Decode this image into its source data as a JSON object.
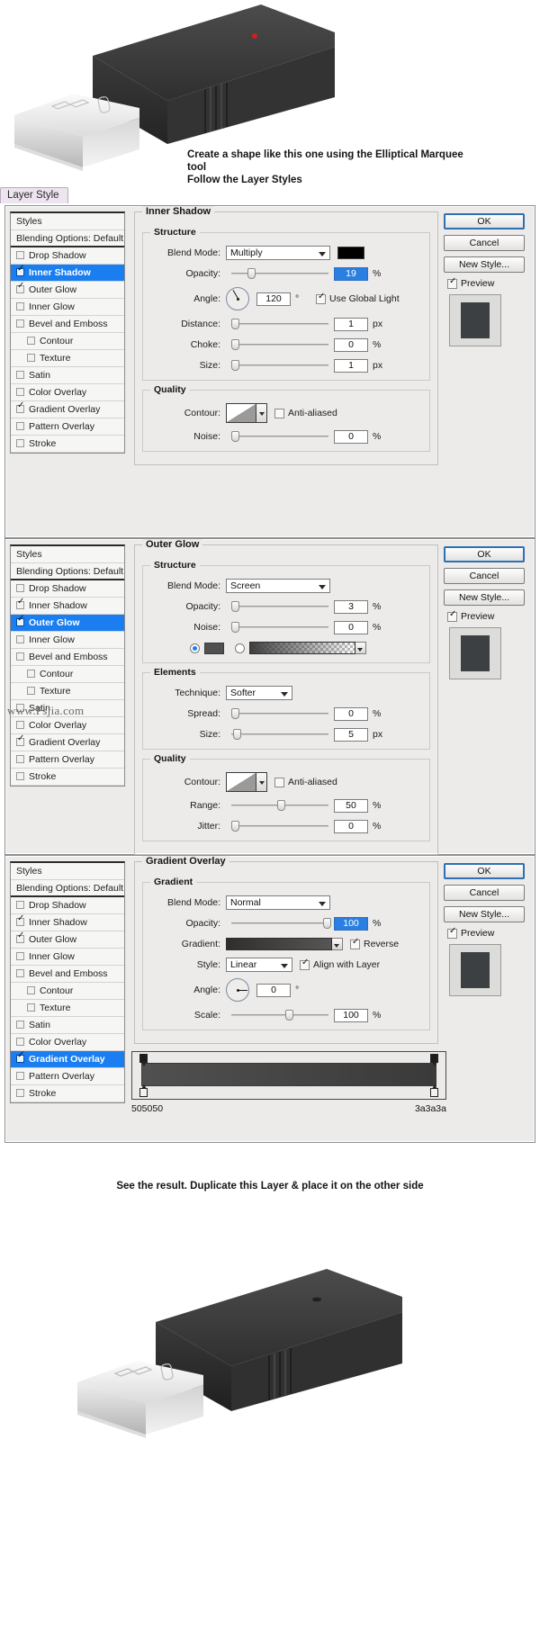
{
  "tutorial": {
    "top_caption_line1": "Create a shape like this one using the Elliptical Marquee tool",
    "top_caption_line2": "Follow the Layer Styles",
    "bottom_caption": "See the result. Duplicate this Layer & place it on the other side",
    "watermark": "www.Psjia.com",
    "tab_label": "Layer Style"
  },
  "styles_list": {
    "header": "Styles",
    "blending_options": "Blending Options: Default",
    "items": [
      {
        "label": "Drop Shadow",
        "checked": false,
        "sub": false
      },
      {
        "label": "Inner Shadow",
        "checked": true,
        "sub": false
      },
      {
        "label": "Outer Glow",
        "checked": true,
        "sub": false
      },
      {
        "label": "Inner Glow",
        "checked": false,
        "sub": false
      },
      {
        "label": "Bevel and Emboss",
        "checked": false,
        "sub": false
      },
      {
        "label": "Contour",
        "checked": false,
        "sub": true
      },
      {
        "label": "Texture",
        "checked": false,
        "sub": true
      },
      {
        "label": "Satin",
        "checked": false,
        "sub": false
      },
      {
        "label": "Color Overlay",
        "checked": false,
        "sub": false
      },
      {
        "label": "Gradient Overlay",
        "checked": true,
        "sub": false
      },
      {
        "label": "Pattern Overlay",
        "checked": false,
        "sub": false
      },
      {
        "label": "Stroke",
        "checked": false,
        "sub": false
      }
    ]
  },
  "buttons": {
    "ok": "OK",
    "cancel": "Cancel",
    "new_style": "New Style...",
    "preview": "Preview"
  },
  "panel_inner_shadow": {
    "title": "Inner Shadow",
    "structure_legend": "Structure",
    "quality_legend": "Quality",
    "blend_mode_label": "Blend Mode:",
    "blend_mode_value": "Multiply",
    "color": "#000000",
    "opacity_label": "Opacity:",
    "opacity_value": "19",
    "opacity_unit": "%",
    "angle_label": "Angle:",
    "angle_value": "120",
    "angle_unit": "°",
    "use_global_light": "Use Global Light",
    "use_global_light_checked": true,
    "distance_label": "Distance:",
    "distance_value": "1",
    "distance_unit": "px",
    "choke_label": "Choke:",
    "choke_value": "0",
    "choke_unit": "%",
    "size_label": "Size:",
    "size_value": "1",
    "size_unit": "px",
    "contour_label": "Contour:",
    "anti_aliased_label": "Anti-aliased",
    "anti_aliased_checked": false,
    "noise_label": "Noise:",
    "noise_value": "0",
    "noise_unit": "%"
  },
  "panel_outer_glow": {
    "title": "Outer Glow",
    "structure_legend": "Structure",
    "elements_legend": "Elements",
    "quality_legend": "Quality",
    "blend_mode_label": "Blend Mode:",
    "blend_mode_value": "Screen",
    "opacity_label": "Opacity:",
    "opacity_value": "3",
    "opacity_unit": "%",
    "noise_label": "Noise:",
    "noise_value": "0",
    "noise_unit": "%",
    "color_mode_selected": "solid",
    "technique_label": "Technique:",
    "technique_value": "Softer",
    "spread_label": "Spread:",
    "spread_value": "0",
    "spread_unit": "%",
    "size_label": "Size:",
    "size_value": "5",
    "size_unit": "px",
    "contour_label": "Contour:",
    "anti_aliased_label": "Anti-aliased",
    "anti_aliased_checked": false,
    "range_label": "Range:",
    "range_value": "50",
    "range_unit": "%",
    "jitter_label": "Jitter:",
    "jitter_value": "0",
    "jitter_unit": "%"
  },
  "panel_gradient_overlay": {
    "title": "Gradient Overlay",
    "gradient_legend": "Gradient",
    "blend_mode_label": "Blend Mode:",
    "blend_mode_value": "Normal",
    "opacity_label": "Opacity:",
    "opacity_value": "100",
    "opacity_unit": "%",
    "gradient_label": "Gradient:",
    "reverse_label": "Reverse",
    "reverse_checked": true,
    "style_label": "Style:",
    "style_value": "Linear",
    "align_with_layer_label": "Align with Layer",
    "align_with_layer_checked": true,
    "angle_label": "Angle:",
    "angle_value": "0",
    "angle_unit": "°",
    "scale_label": "Scale:",
    "scale_value": "100",
    "scale_unit": "%",
    "gradient_editor": {
      "left_hex": "505050",
      "right_hex": "3a3a3a"
    }
  }
}
